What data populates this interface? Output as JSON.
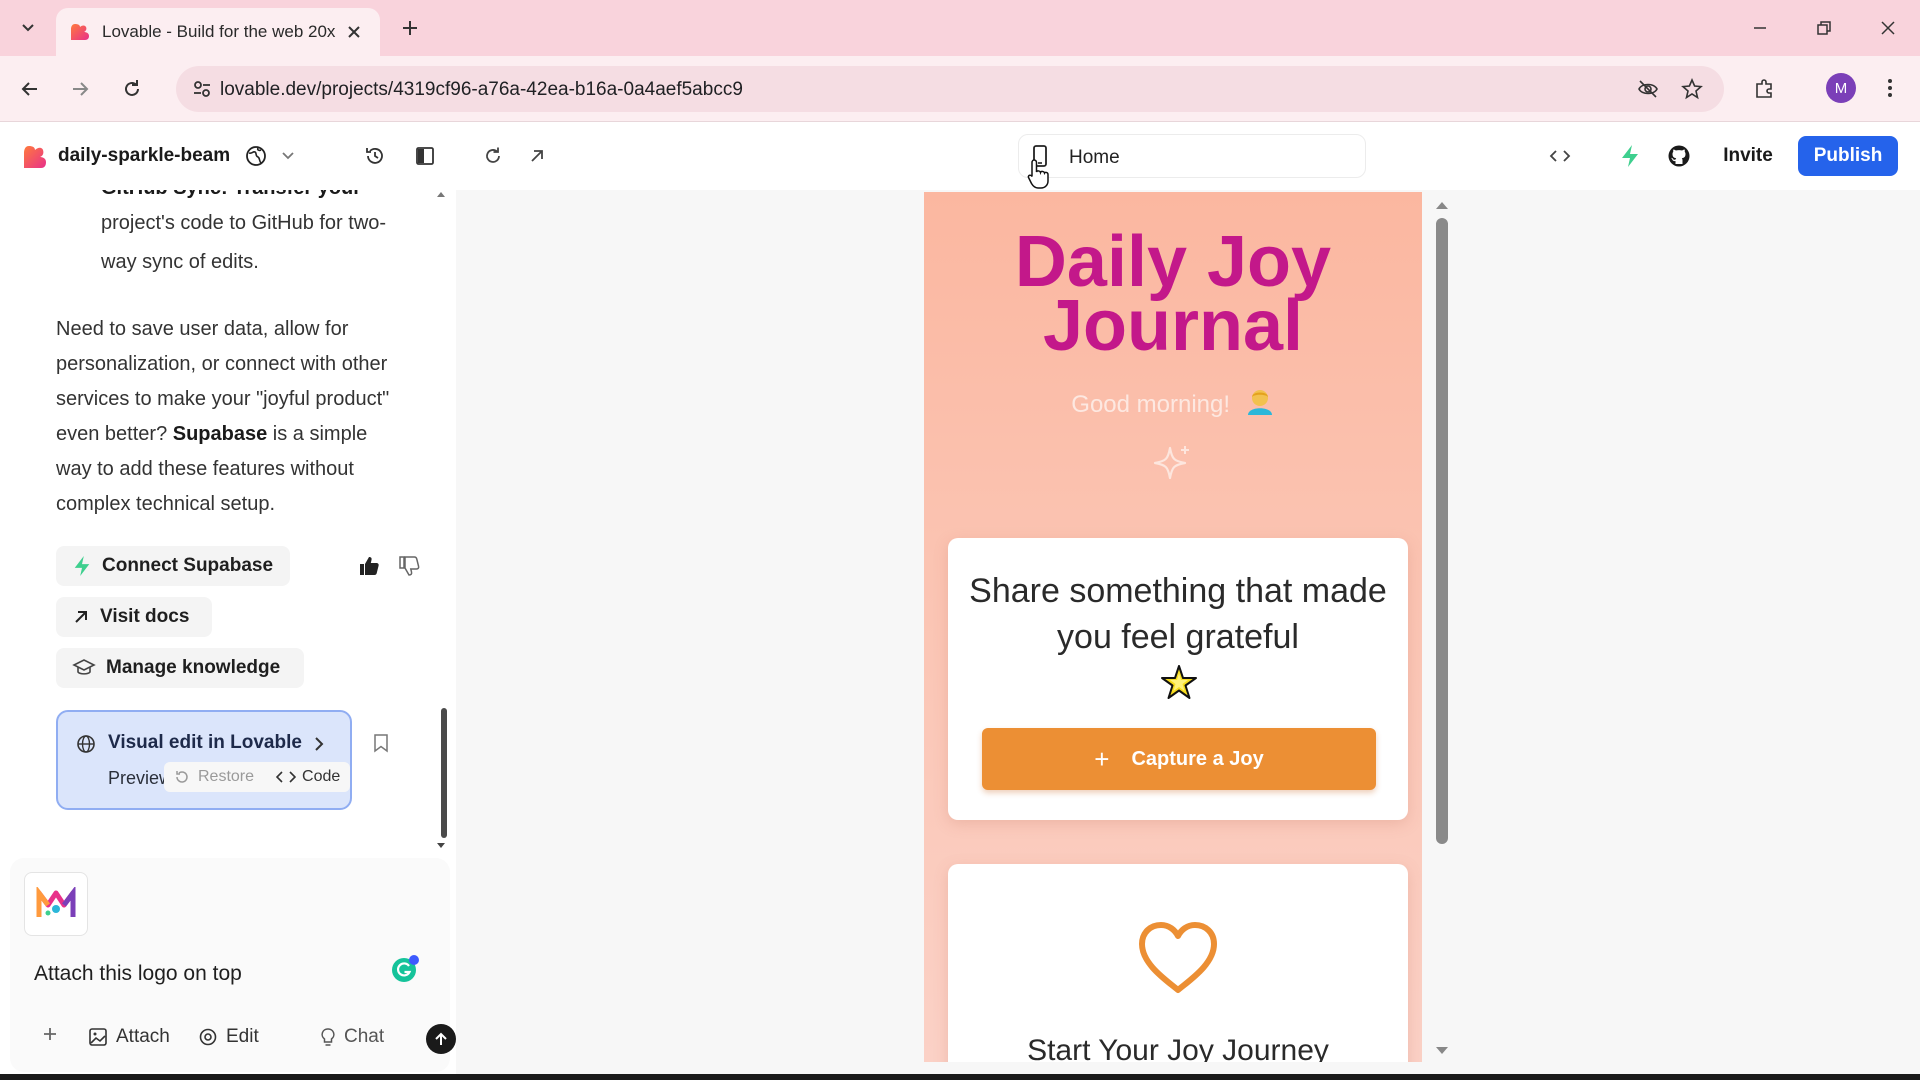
{
  "browser": {
    "tab_title": "Lovable - Build for the web 20x",
    "url": "lovable.dev/projects/4319cf96-a76a-42ea-b16a-0a4aef5abcc9",
    "profile_initial": "M"
  },
  "header": {
    "project_name": "daily-sparkle-beam",
    "route": "Home",
    "invite_label": "Invite",
    "publish_label": "Publish"
  },
  "chat": {
    "partial_line_1": "GitHub Sync: Transfer your",
    "partial_line_2": "project's code to GitHub for two-",
    "partial_line_3": "way sync of edits.",
    "para_line_1": "Need to save user data, allow for",
    "para_line_2": "personalization, or connect with other",
    "para_line_3": "services to make your \"joyful product\"",
    "para_line_4a": "even better? ",
    "para_line_4b": "Supabase",
    "para_line_4c": " is a simple",
    "para_line_5": "way to add these features without",
    "para_line_6": "complex technical setup.",
    "connect_supabase": "Connect Supabase",
    "visit_docs": "Visit docs",
    "manage_knowledge": "Manage knowledge",
    "visual_edit_title": "Visual edit in Lovable",
    "visual_edit_sub": "Preview Latest",
    "restore_label": "Restore",
    "code_label": "Code",
    "prompt_text": "Attach this logo on top",
    "attach_label": "Attach",
    "edit_label": "Edit",
    "chat_label": "Chat"
  },
  "preview": {
    "title_line_1": "Daily Joy",
    "title_line_2": "Journal",
    "greeting": "Good morning!",
    "card1_text": "Share something that made you feel grateful",
    "capture_label": "Capture a Joy",
    "card2_text": "Start Your Joy Journey"
  },
  "colors": {
    "accent_blue": "#2563eb",
    "title_magenta": "#c3188a",
    "capture_orange": "#ec8f34",
    "tab_bar_pink": "#f9d3dc"
  },
  "icons": [
    "chevron-down-icon",
    "lovable-favicon",
    "close-icon",
    "plus-icon",
    "back-icon",
    "forward-icon",
    "reload-icon",
    "site-info-icon",
    "eye-off-icon",
    "star-icon",
    "extensions-icon",
    "kebab-menu-icon",
    "globe-icon",
    "history-icon",
    "sidebar-icon",
    "refresh-icon",
    "open-external-icon",
    "phone-icon",
    "code-icon",
    "bolt-icon",
    "github-icon",
    "thumbs-up-icon",
    "thumbs-down-icon",
    "arrow-up-right-icon",
    "graduation-cap-icon",
    "bookmark-icon",
    "image-icon",
    "target-icon",
    "lightbulb-icon",
    "arrow-up-icon",
    "sparkle-icon",
    "heart-icon"
  ]
}
